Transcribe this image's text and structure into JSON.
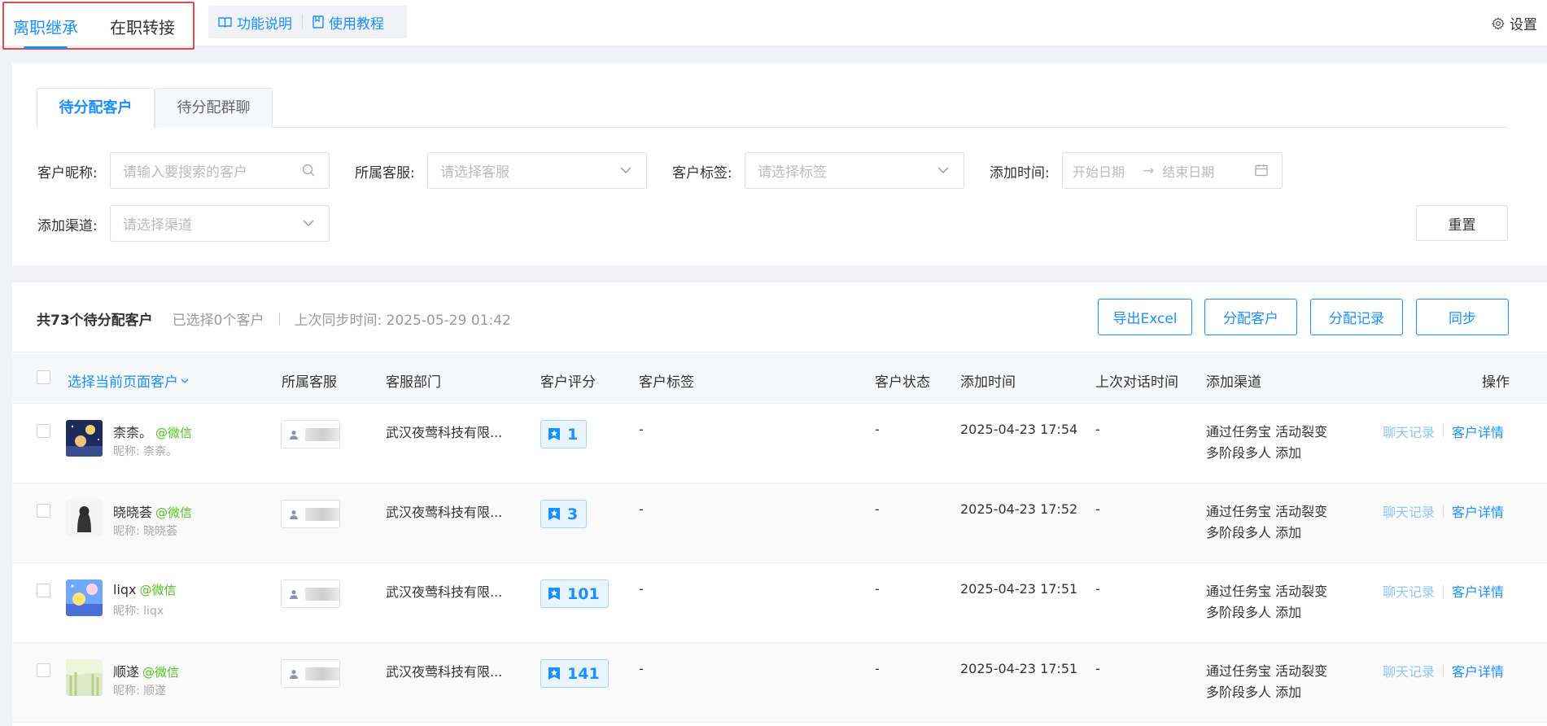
{
  "topbar": {
    "mode_tabs": [
      "离职继承",
      "在职转接"
    ],
    "help_links": [
      "功能说明",
      "使用教程"
    ],
    "settings_label": "设置"
  },
  "filters": {
    "sub_tabs": [
      "待分配客户",
      "待分配群聊"
    ],
    "nickname": {
      "label": "客户昵称:",
      "placeholder": "请输入要搜索的客户"
    },
    "staff": {
      "label": "所属客服:",
      "placeholder": "请选择客服"
    },
    "tag": {
      "label": "客户标签:",
      "placeholder": "请选择标签"
    },
    "add_time": {
      "label": "添加时间:",
      "start": "开始日期",
      "end": "结束日期"
    },
    "channel": {
      "label": "添加渠道:",
      "placeholder": "请选择渠道"
    },
    "reset_label": "重置"
  },
  "list": {
    "total_text": "共73个待分配客户",
    "selected_text": "已选择0个客户",
    "sync_text": "上次同步时间: 2025-05-29 01:42",
    "actions": [
      "导出Excel",
      "分配客户",
      "分配记录",
      "同步"
    ],
    "columns": {
      "select_page": "选择当前页面客户",
      "staff": "所属客服",
      "dept": "客服部门",
      "score": "客户评分",
      "tags": "客户标签",
      "status": "客户状态",
      "add_time": "添加时间",
      "last_chat": "上次对话时间",
      "channel": "添加渠道",
      "ops": "操作"
    },
    "rows": [
      {
        "name": "柰柰。",
        "source": "@微信",
        "nick": "昵称: 柰柰。",
        "dept": "武汉夜莺科技有限...",
        "score": "1",
        "tags": "-",
        "status": "-",
        "add_time": "2025-04-23 17:54",
        "last_chat": "-",
        "channel": [
          "通过任务宝 活动裂变",
          "多阶段多人 添加"
        ],
        "op_chat": "聊天记录",
        "op_detail": "客户详情"
      },
      {
        "name": "晓晓荟",
        "source": "@微信",
        "nick": "昵称: 晓晓荟",
        "dept": "武汉夜莺科技有限...",
        "score": "3",
        "tags": "-",
        "status": "-",
        "add_time": "2025-04-23 17:52",
        "last_chat": "-",
        "channel": [
          "通过任务宝 活动裂变",
          "多阶段多人 添加"
        ],
        "op_chat": "聊天记录",
        "op_detail": "客户详情"
      },
      {
        "name": "liqx",
        "source": "@微信",
        "nick": "昵称: liqx",
        "dept": "武汉夜莺科技有限...",
        "score": "101",
        "tags": "-",
        "status": "-",
        "add_time": "2025-04-23 17:51",
        "last_chat": "-",
        "channel": [
          "通过任务宝 活动裂变",
          "多阶段多人 添加"
        ],
        "op_chat": "聊天记录",
        "op_detail": "客户详情"
      },
      {
        "name": "顺遂",
        "source": "@微信",
        "nick": "昵称: 顺遂",
        "dept": "武汉夜莺科技有限...",
        "score": "141",
        "tags": "-",
        "status": "-",
        "add_time": "2025-04-23 17:51",
        "last_chat": "-",
        "channel": [
          "通过任务宝 活动裂变",
          "多阶段多人 添加"
        ],
        "op_chat": "聊天记录",
        "op_detail": "客户详情"
      }
    ]
  },
  "colors": {
    "accent": "#1890ff",
    "wechat": "#52c41a",
    "highlight_border": "#e5484d"
  }
}
